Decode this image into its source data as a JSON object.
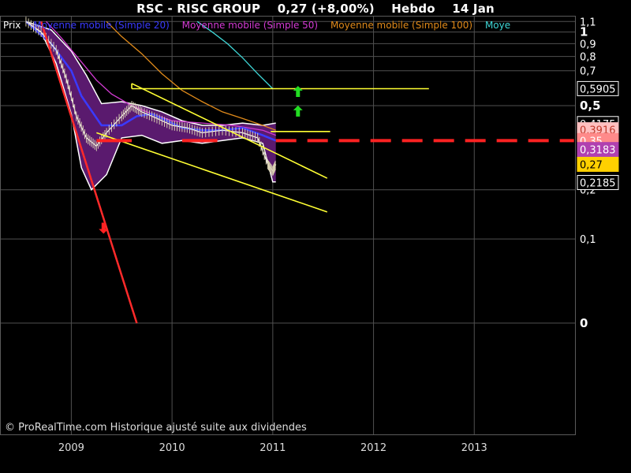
{
  "header": {
    "ticker": "RSC - RISC GROUP",
    "quote": "0,27 (+8,00%)",
    "period": "Hebdo",
    "date": "14 Jan"
  },
  "legend": [
    {
      "label": "Prix",
      "color": "#ffffff"
    },
    {
      "label": "Moyenne mobile (Simple 20)",
      "color": "#3a3aff"
    },
    {
      "label": "Moyenne mobile (Simple 50)",
      "color": "#d43bd4"
    },
    {
      "label": "Moyenne mobile (Simple 100)",
      "color": "#e08a1a"
    },
    {
      "label": "Moye",
      "color": "#3fd7d7"
    }
  ],
  "credit": "© ProRealTime.com Historique ajusté suite aux dividendes",
  "chart_data": {
    "type": "line",
    "y_scale": "log",
    "ylim": [
      0,
      1.1
    ],
    "y_ticks": [
      "1,1",
      "1",
      "0,9",
      "0,8",
      "0,7",
      "0,5",
      "0,2",
      "0,1",
      "0"
    ],
    "x_ticks": [
      "2009",
      "2010",
      "2011",
      "2012",
      "2013"
    ],
    "grid": true,
    "series": [
      {
        "name": "Prix",
        "color": "#ffffff",
        "x": [
          2008.55,
          2008.7,
          2008.85,
          2008.95,
          2009.05,
          2009.15,
          2009.25,
          2009.35,
          2009.5,
          2009.6,
          2009.7,
          2009.85,
          2010.0,
          2010.15,
          2010.3,
          2010.5,
          2010.7,
          2010.85,
          2010.95,
          2011.0,
          2011.03
        ],
        "y": [
          1.1,
          1.0,
          0.85,
          0.65,
          0.45,
          0.36,
          0.33,
          0.38,
          0.45,
          0.5,
          0.47,
          0.44,
          0.41,
          0.4,
          0.38,
          0.39,
          0.38,
          0.36,
          0.27,
          0.25,
          0.27
        ]
      },
      {
        "name": "Moyenne mobile (Simple 20)",
        "color": "#3a3aff",
        "x": [
          2008.55,
          2008.8,
          2009.0,
          2009.1,
          2009.3,
          2009.5,
          2009.65,
          2009.8,
          2009.95,
          2010.1,
          2010.3,
          2010.5,
          2010.7,
          2010.9,
          2011.03
        ],
        "y": [
          1.1,
          0.9,
          0.7,
          0.55,
          0.41,
          0.41,
          0.45,
          0.46,
          0.43,
          0.4,
          0.39,
          0.39,
          0.4,
          0.37,
          0.35
        ]
      },
      {
        "name": "Moyenne mobile (Simple 50)",
        "color": "#d43bd4",
        "x": [
          2008.75,
          2008.9,
          2009.0,
          2009.1,
          2009.25,
          2009.4,
          2009.6,
          2009.8,
          2010.0,
          2010.3,
          2010.6,
          2010.9,
          2011.03
        ],
        "y": [
          1.1,
          0.95,
          0.85,
          0.76,
          0.64,
          0.56,
          0.5,
          0.46,
          0.43,
          0.42,
          0.41,
          0.39,
          0.37
        ]
      },
      {
        "name": "Moyenne mobile (Simple 100)",
        "color": "#e08a1a",
        "x": [
          2009.35,
          2009.5,
          2009.7,
          2009.9,
          2010.1,
          2010.3,
          2010.5,
          2010.7,
          2010.9,
          2011.03
        ],
        "y": [
          1.1,
          0.96,
          0.82,
          0.68,
          0.58,
          0.52,
          0.47,
          0.44,
          0.41,
          0.39
        ]
      },
      {
        "name": "Moye",
        "color": "#3fd7d7",
        "x": [
          2010.25,
          2010.4,
          2010.55,
          2010.7,
          2010.85,
          2011.0
        ],
        "y": [
          1.1,
          1.0,
          0.9,
          0.79,
          0.68,
          0.59
        ]
      }
    ],
    "bollinger_upper": {
      "x": [
        2008.55,
        2008.8,
        2009.0,
        2009.15,
        2009.3,
        2009.5,
        2009.7,
        2009.9,
        2010.1,
        2010.3,
        2010.5,
        2010.7,
        2010.9,
        2011.03
      ],
      "y": [
        1.1,
        1.02,
        0.84,
        0.67,
        0.51,
        0.52,
        0.5,
        0.47,
        0.43,
        0.41,
        0.41,
        0.42,
        0.41,
        0.42
      ]
    },
    "bollinger_lower": {
      "x": [
        2008.55,
        2008.7,
        2008.85,
        2009.0,
        2009.1,
        2009.2,
        2009.35,
        2009.5,
        2009.7,
        2009.9,
        2010.1,
        2010.3,
        2010.5,
        2010.7,
        2010.9,
        2011.0,
        2011.03
      ],
      "y": [
        1.1,
        1.0,
        0.75,
        0.46,
        0.26,
        0.2,
        0.24,
        0.36,
        0.37,
        0.34,
        0.35,
        0.34,
        0.35,
        0.36,
        0.34,
        0.22,
        0.22
      ]
    },
    "trend_lines": [
      {
        "color": "#ff2a2a",
        "x": [
          2008.7,
          2009.65
        ],
        "y": [
          1.1,
          0.0
        ]
      },
      {
        "color": "#ffff33",
        "x": [
          2009.6,
          2011.54
        ],
        "y": [
          0.62,
          0.23
        ]
      },
      {
        "color": "#ffff33",
        "x": [
          2009.25,
          2011.54
        ],
        "y": [
          0.38,
          0.15
        ]
      },
      {
        "color": "#ffff33",
        "x": [
          2009.6,
          2012.55
        ],
        "y": [
          0.59,
          0.59
        ]
      },
      {
        "color": "#ffff33",
        "x": [
          2010.98,
          2011.57
        ],
        "y": [
          0.385,
          0.385
        ]
      },
      {
        "color": "#ffff33",
        "x": [
          2009.6,
          2009.6
        ],
        "y": [
          0.59,
          0.62
        ]
      }
    ],
    "support_lines": [
      {
        "color": "#ff2222",
        "dashed": false,
        "x": [
          2009.25,
          2009.6
        ],
        "y": [
          0.35,
          0.35
        ]
      },
      {
        "color": "#ff2222",
        "dashed": false,
        "x": [
          2010.1,
          2010.45
        ],
        "y": [
          0.35,
          0.35
        ]
      },
      {
        "color": "#ff2222",
        "dashed": true,
        "x": [
          2011.03,
          2013.99
        ],
        "y": [
          0.35,
          0.35
        ]
      }
    ],
    "markers": [
      {
        "type": "arrow-up",
        "color": "#22dd22",
        "x": 2011.25,
        "y": 0.57
      },
      {
        "type": "arrow-up",
        "color": "#22dd22",
        "x": 2011.25,
        "y": 0.47
      },
      {
        "type": "arrow-down",
        "color": "#ff2222",
        "x": 2009.32,
        "y": 0.12
      }
    ],
    "value_labels": [
      {
        "text": "0,5905",
        "value": 0.5905,
        "bg": "#000000",
        "fg": "#ffffff",
        "border": "#ffffff"
      },
      {
        "text": "0,4175",
        "value": 0.4175,
        "bg": "#000000",
        "fg": "#ffffff",
        "border": "#ffffff"
      },
      {
        "text": "0,3916",
        "value": 0.392,
        "bg": "#ffc0c0",
        "fg": "#c0392b",
        "border": "#ffc0c0"
      },
      {
        "text": "0,35",
        "value": 0.35,
        "bg": "#ff8a8a",
        "fg": "#ffffff",
        "border": "#ff8a8a"
      },
      {
        "text": "0,3183",
        "value": 0.318,
        "bg": "#b040b0",
        "fg": "#ffffff",
        "border": "#b040b0"
      },
      {
        "text": "0,27",
        "value": 0.27,
        "bg": "#ffd000",
        "fg": "#000000",
        "border": "#ffd000"
      },
      {
        "text": "0,2185",
        "value": 0.2185,
        "bg": "#000000",
        "fg": "#ffffff",
        "border": "#ffffff"
      }
    ]
  }
}
